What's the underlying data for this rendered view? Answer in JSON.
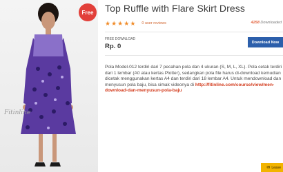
{
  "product": {
    "image_watermark": "Fitinline",
    "badge_label": "Free",
    "title": "Top Ruffle with Flare Skirt Dress",
    "rating": {
      "stars": 5,
      "star_glyph": "★",
      "reviews_label": "0 user reviews"
    },
    "downloads": {
      "count": "4258",
      "label": "Downloaded"
    },
    "price_label": "FREE DOWNLOAD",
    "price_value": "Rp. 0",
    "download_button_label": "Download Now",
    "description_text": "Pola Model-012 terdiri dari 7 pecahan pola dan 4 ukuran (S, M, L, XL). Pola cetak terdiri dari 1 lembar (A0 atau kertas Plotter), sedangkan pola file harus di-download kemudian dicetak menggunakan kertas A4 dan terdiri dari 18 lembar A4. Untuk mendownload dan menyusun pola baju, bisa simak videonya di ",
    "description_link": "http://fitinline.com/course/view/men-download-dan-menyusun-pola-baju"
  },
  "feedback": {
    "label": "Leave",
    "icon": "envelope-icon"
  },
  "colors": {
    "badge": "#e2403a",
    "stars": "#f08c2a",
    "download_button": "#2c5fab",
    "link": "#d2391a",
    "dress": "#5a3aa0",
    "dress_light": "#8a70c9",
    "leave_button": "#f2b400"
  }
}
